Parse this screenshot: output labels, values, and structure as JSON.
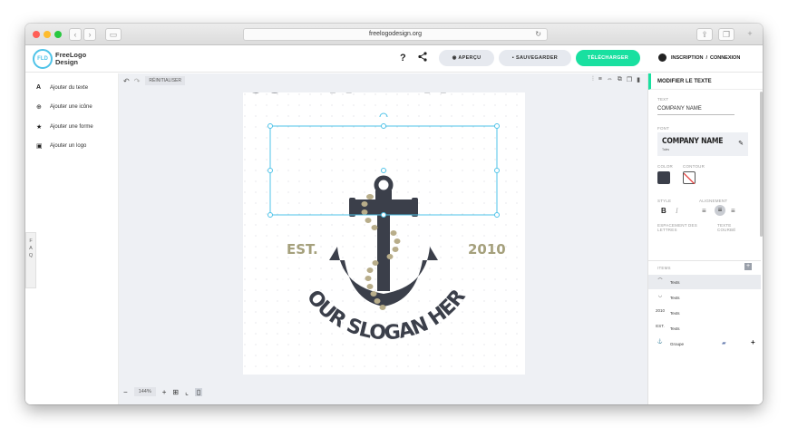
{
  "browser": {
    "url": "freelogodesign.org",
    "reload_icon": "reload-icon"
  },
  "header": {
    "logo_badge": "FLD",
    "logo_line1": "FreeLogo",
    "logo_line2": "Design",
    "help_glyph": "?",
    "preview_label": "APERÇU",
    "save_label": "SAUVEGARDER",
    "download_label": "TÉLÉCHARGER",
    "signup_label": "INSCRIPTION",
    "auth_separator": "/",
    "login_label": "CONNEXION",
    "colors": {
      "accent": "#19e0a0",
      "button_grey": "#e6e9ef"
    }
  },
  "sidebar": {
    "items": [
      {
        "label": "Ajouter du texte",
        "icon": "text-icon"
      },
      {
        "label": "Ajouter une icône",
        "icon": "globe-icon"
      },
      {
        "label": "Ajouter une forme",
        "icon": "star-icon"
      },
      {
        "label": "Ajouter un logo",
        "icon": "image-icon"
      }
    ],
    "faq": [
      "F",
      "A",
      "Q"
    ]
  },
  "canvas": {
    "reset_label": "RÉINITIALISER",
    "zoom": "144%",
    "logo": {
      "company_name": "COMPANY NAME",
      "est_label": "EST.",
      "year": "2010",
      "slogan": "YOUR SLOGAN HERE",
      "colors": {
        "dark": "#3b3f4a",
        "gold": "#a5a07c",
        "rope": "#b8ad8a",
        "selection": "#4fc3e8"
      }
    }
  },
  "panel": {
    "title": "MODIFIER LE TEXTE",
    "text_label": "TEXT",
    "text_value": "COMPANY NAME",
    "font_label": "FONT",
    "font_preview": "COMPANY NAME",
    "font_sub": "Tales",
    "color_label": "COLOR",
    "outline_label": "CONTOUR",
    "style_label": "STYLE",
    "bold_glyph": "B",
    "italic_glyph": "I",
    "align_label": "ALIGNEMENT",
    "letter_spacing_label": "ESPACEMENT DES LETTRES",
    "curve_label": "TEXTE COURBÉ",
    "items_label": "ITEMS",
    "layers": [
      {
        "label": "Texts",
        "icon": "curve-up-icon"
      },
      {
        "label": "Texts",
        "icon": "curve-down-icon"
      },
      {
        "label": "Texts",
        "glyph": "2010"
      },
      {
        "label": "Texts",
        "glyph": "EST."
      },
      {
        "label": "Groupe",
        "icon": "anchor-icon"
      }
    ]
  }
}
